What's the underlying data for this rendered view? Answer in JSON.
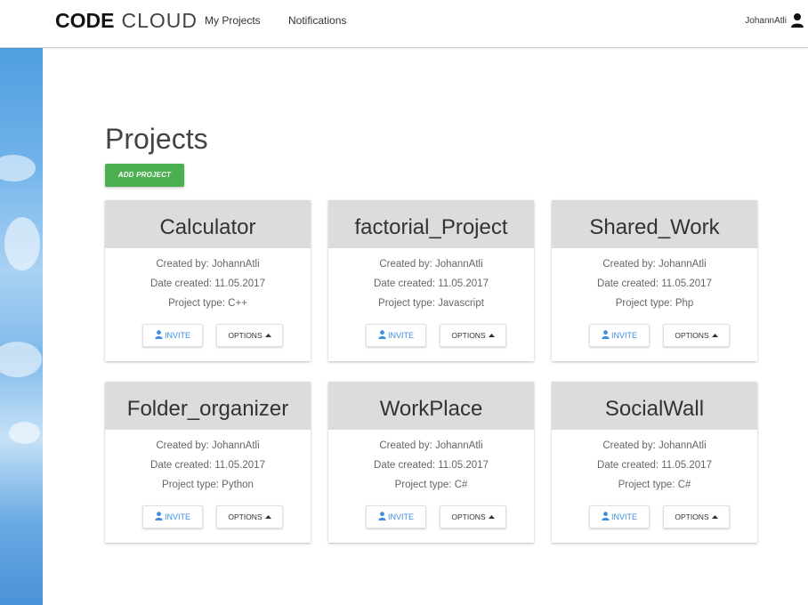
{
  "navbar": {
    "brand_bold": "CODE",
    "brand_light": "CLOUD",
    "links": [
      "My Projects",
      "Notifications"
    ],
    "username": "JohannAtli",
    "user_icon": "user-icon"
  },
  "page": {
    "title": "Projects",
    "add_button": "ADD PROJECT"
  },
  "projects": [
    {
      "name": "Calculator",
      "created_by": "Created by: JohannAtli",
      "date": "Date created: 11.05.2017",
      "type": "Project type: C++"
    },
    {
      "name": "factorial_Project",
      "created_by": "Created by: JohannAtli",
      "date": "Date created: 11.05.2017",
      "type": "Project type: Javascript"
    },
    {
      "name": "Shared_Work",
      "created_by": "Created by: JohannAtli",
      "date": "Date created: 11.05.2017",
      "type": "Project type: Php"
    },
    {
      "name": "Folder_organizer",
      "created_by": "Created by: JohannAtli",
      "date": "Date created: 11.05.2017",
      "type": "Project type: Python"
    },
    {
      "name": "WorkPlace",
      "created_by": "Created by: JohannAtli",
      "date": "Date created: 11.05.2017",
      "type": "Project type: C#"
    },
    {
      "name": "SocialWall",
      "created_by": "Created by: JohannAtli",
      "date": "Date created: 11.05.2017",
      "type": "Project type: C#"
    }
  ],
  "card_buttons": {
    "invite": "INVITE",
    "options": "OPTIONS"
  },
  "colors": {
    "accent_green": "#4caf50",
    "invite_blue": "#3c8de0",
    "card_header": "#dcdcdc"
  }
}
